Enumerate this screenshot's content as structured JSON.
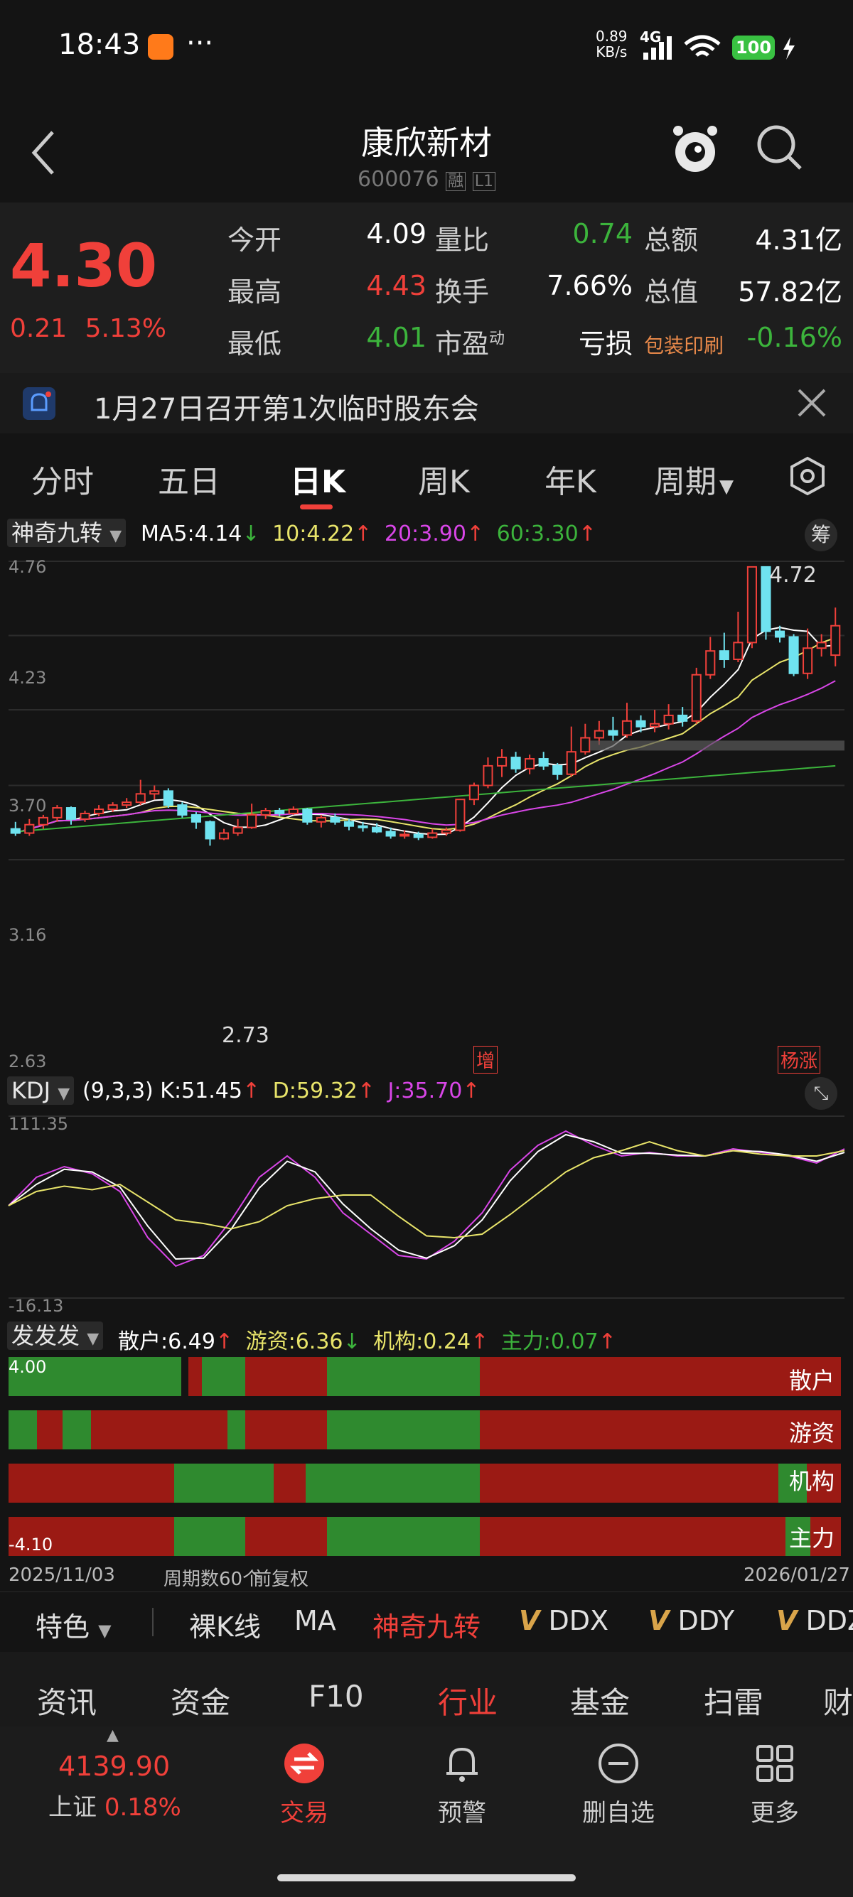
{
  "status_bar": {
    "time": "18:43",
    "dots": "···",
    "net_speed": "0.89",
    "net_unit": "KB/s",
    "signal": "4G",
    "battery": "100"
  },
  "header": {
    "title": "康欣新材",
    "code": "600076",
    "badge1": "融",
    "badge2": "L1"
  },
  "quote": {
    "price": "4.30",
    "change": "0.21",
    "change_pct": "5.13%",
    "rows": [
      [
        {
          "label": "今开",
          "value": "4.09",
          "color": "white"
        },
        {
          "label": "量比",
          "value": "0.74",
          "color": "green"
        },
        {
          "label": "总额",
          "value": "4.31亿",
          "color": "white"
        }
      ],
      [
        {
          "label": "最高",
          "value": "4.43",
          "color": "red"
        },
        {
          "label": "换手",
          "value": "7.66%",
          "color": "white"
        },
        {
          "label": "总值",
          "value": "57.82亿",
          "color": "white"
        }
      ],
      [
        {
          "label": "最低",
          "value": "4.01",
          "color": "green"
        },
        {
          "label": "市盈",
          "sup": "动",
          "value": "亏损",
          "color": "white"
        },
        {
          "label": "包装印刷",
          "value": "-0.16%",
          "color": "green"
        }
      ]
    ]
  },
  "notice": {
    "text": "1月27日召开第1次临时股东会"
  },
  "tabs": [
    "分时",
    "五日",
    "日K",
    "周K",
    "年K",
    "周期"
  ],
  "chart": {
    "indicator_name": "神奇九转",
    "ma_legend": [
      {
        "text": "MA5:4.14",
        "arrow": "↓",
        "color": "#ffffff",
        "arrow_color": "#3cb43c"
      },
      {
        "text": "10:4.22",
        "arrow": "↑",
        "color": "#e8e46a",
        "arrow_color": "#f0403a"
      },
      {
        "text": "20:3.90",
        "arrow": "↑",
        "color": "#d946e8",
        "arrow_color": "#f0403a"
      },
      {
        "text": "60:3.30",
        "arrow": "↑",
        "color": "#3cb43c",
        "arrow_color": "#f0403a"
      }
    ],
    "chou_label": "筹",
    "y_ticks": [
      "4.76",
      "4.23",
      "3.70",
      "3.16",
      "2.63"
    ],
    "high_label": "4.72",
    "low_label": "2.73",
    "zeng_label": "增",
    "yangzhang_label": "杨涨",
    "kdj_name": "KDJ",
    "kdj_params": "(9,3,3)",
    "kdj_legend": [
      {
        "text": "K:51.45",
        "arrow": "↑",
        "color": "#ffffff"
      },
      {
        "text": "D:59.32",
        "arrow": "↑",
        "color": "#e8e46a"
      },
      {
        "text": "J:35.70",
        "arrow": "↑",
        "color": "#d946e8"
      }
    ],
    "kdj_ticks": [
      "111.35",
      "-16.13"
    ],
    "fff_name": "发发发",
    "fff_legend": [
      {
        "text": "散户:6.49",
        "arrow": "↑",
        "color": "#ffffff"
      },
      {
        "text": "游资:6.36",
        "arrow": "↓",
        "color": "#e8e46a"
      },
      {
        "text": "机构:0.24",
        "arrow": "↑",
        "color": "#e8e46a"
      },
      {
        "text": "主力:0.07",
        "arrow": "↑",
        "color": "#3cb43c"
      }
    ],
    "fff_ticks": [
      "4.00",
      "-4.10"
    ],
    "fff_rows": [
      "散户",
      "游资",
      "机构",
      "主力"
    ],
    "date_start": "2025/11/03",
    "period_count": "周期数60个",
    "adjust": "前复权",
    "date_end": "2026/01/27"
  },
  "feature_bar": {
    "special": "特色",
    "items": [
      "裸K线",
      "MA",
      "神奇九转",
      "DDX",
      "DDY",
      "DDZ"
    ]
  },
  "sub_tabs": [
    "资讯",
    "资金",
    "F10",
    "行业",
    "基金",
    "扫雷",
    "财"
  ],
  "bottom_nav": {
    "index_value": "4139.90",
    "index_name": "上证",
    "index_pct": "0.18%",
    "items": [
      "交易",
      "预警",
      "删自选",
      "更多"
    ]
  },
  "chart_data": {
    "type": "candlestick",
    "ylim": [
      2.63,
      4.76
    ],
    "candles": [
      [
        2.85,
        2.82,
        2.9,
        2.8
      ],
      [
        2.82,
        2.88,
        2.92,
        2.8
      ],
      [
        2.88,
        2.93,
        2.95,
        2.85
      ],
      [
        2.93,
        3.0,
        3.02,
        2.9
      ],
      [
        3.0,
        2.92,
        3.01,
        2.88
      ],
      [
        2.92,
        2.96,
        2.98,
        2.9
      ],
      [
        2.96,
        2.99,
        3.02,
        2.94
      ],
      [
        2.99,
        3.02,
        3.04,
        2.97
      ],
      [
        3.02,
        3.04,
        3.07,
        3.0
      ],
      [
        3.04,
        3.1,
        3.2,
        3.02
      ],
      [
        3.1,
        3.12,
        3.16,
        3.06
      ],
      [
        3.12,
        3.02,
        3.14,
        3.0
      ],
      [
        3.02,
        2.95,
        3.04,
        2.93
      ],
      [
        2.95,
        2.9,
        2.97,
        2.85
      ],
      [
        2.9,
        2.78,
        2.91,
        2.73
      ],
      [
        2.78,
        2.82,
        2.85,
        2.77
      ],
      [
        2.82,
        2.86,
        2.92,
        2.8
      ],
      [
        2.86,
        2.95,
        3.03,
        2.85
      ],
      [
        2.95,
        2.98,
        3.0,
        2.92
      ],
      [
        2.98,
        2.96,
        3.0,
        2.94
      ],
      [
        2.96,
        2.99,
        3.01,
        2.95
      ],
      [
        2.99,
        2.9,
        3.0,
        2.88
      ],
      [
        2.9,
        2.93,
        2.95,
        2.86
      ],
      [
        2.93,
        2.9,
        2.96,
        2.88
      ],
      [
        2.9,
        2.87,
        2.92,
        2.84
      ],
      [
        2.87,
        2.86,
        2.9,
        2.83
      ],
      [
        2.86,
        2.83,
        2.89,
        2.82
      ],
      [
        2.83,
        2.8,
        2.86,
        2.78
      ],
      [
        2.8,
        2.81,
        2.84,
        2.78
      ],
      [
        2.81,
        2.79,
        2.83,
        2.77
      ],
      [
        2.79,
        2.82,
        2.85,
        2.78
      ],
      [
        2.82,
        2.84,
        2.86,
        2.8
      ],
      [
        2.84,
        3.06,
        3.06,
        2.83
      ],
      [
        3.06,
        3.16,
        3.18,
        3.02
      ],
      [
        3.16,
        3.3,
        3.36,
        3.14
      ],
      [
        3.3,
        3.36,
        3.42,
        3.22
      ],
      [
        3.36,
        3.28,
        3.4,
        3.25
      ],
      [
        3.28,
        3.35,
        3.38,
        3.24
      ],
      [
        3.35,
        3.3,
        3.4,
        3.27
      ],
      [
        3.3,
        3.24,
        3.32,
        3.2
      ],
      [
        3.24,
        3.4,
        3.58,
        3.22
      ],
      [
        3.4,
        3.5,
        3.6,
        3.38
      ],
      [
        3.5,
        3.55,
        3.62,
        3.45
      ],
      [
        3.55,
        3.52,
        3.65,
        3.48
      ],
      [
        3.52,
        3.62,
        3.75,
        3.5
      ],
      [
        3.62,
        3.58,
        3.66,
        3.54
      ],
      [
        3.58,
        3.6,
        3.7,
        3.54
      ],
      [
        3.6,
        3.66,
        3.74,
        3.56
      ],
      [
        3.66,
        3.62,
        3.72,
        3.58
      ],
      [
        3.62,
        3.95,
        4.0,
        3.6
      ],
      [
        3.95,
        4.12,
        4.22,
        3.92
      ],
      [
        4.12,
        4.06,
        4.25,
        4.0
      ],
      [
        4.06,
        4.18,
        4.4,
        4.04
      ],
      [
        4.18,
        4.72,
        4.72,
        4.14
      ],
      [
        4.72,
        4.26,
        4.72,
        4.2
      ],
      [
        4.26,
        4.22,
        4.3,
        4.18
      ],
      [
        4.22,
        3.96,
        4.24,
        3.94
      ],
      [
        3.96,
        4.14,
        4.28,
        3.92
      ],
      [
        4.14,
        4.18,
        4.24,
        4.08
      ],
      [
        4.09,
        4.3,
        4.43,
        4.01
      ]
    ]
  }
}
